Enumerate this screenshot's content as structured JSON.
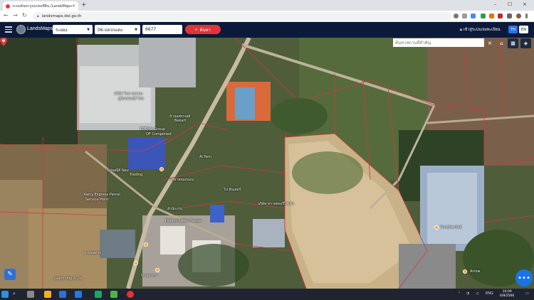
{
  "browser": {
    "tab_title": "ระบบค้นหารูปแปลงที่ดิน (LandsMaps...",
    "tab_close": "×",
    "new_tab": "+",
    "url": "landsmaps.dol.go.th",
    "controls": {
      "minimize": "–",
      "maximize": "☐",
      "close": "×"
    }
  },
  "app": {
    "brand": "LandsMaps",
    "province_select": "ระยอง",
    "district_select": "06-ปลวกแดง",
    "parcel_number": "6677",
    "search_button": "ค้นหา",
    "login_link": "เข้าสู่ระบบ/ลงทะเบียน",
    "lang_th": "TH",
    "lang_en": "EN"
  },
  "map": {
    "search_placeholder": "ค้นหาสถานที่สำคัญ",
    "close": "×",
    "labels": [
      "บริษัท ไทย เยนาบะ",
      "ยูนิเทคสเปย์ ไทย",
      "บ้านแพรกเลย์",
      "Bekart",
      "TOTHAI Group",
      "OF Completed",
      "Ai Fern",
      "ไปรษณีย์ นิคม",
      "Trading",
      "สาขาหนองบอน",
      "Kerry Express Parcel",
      "Service Point",
      "สำนักงาน",
      "Fabinoi tattoo house",
      "ลานจอดรถ",
      "Giant ship & Co",
      "ร้านอาหาร",
      "บริษัท ทรายทองรีไซเคิล",
      "โกดังคิดทรัพย์",
      "Arrow",
      "ไป ฮันเตอร์"
    ]
  },
  "taskbar": {
    "search_icon": "⌕",
    "time": "10:09",
    "date": "6/9/2566",
    "lang": "ENG"
  },
  "colors": {
    "header_bg": "#0b1a3a",
    "search_button": "#e0333a",
    "fab": "#1a73e8",
    "parcel_lines": "#d23a3a"
  }
}
